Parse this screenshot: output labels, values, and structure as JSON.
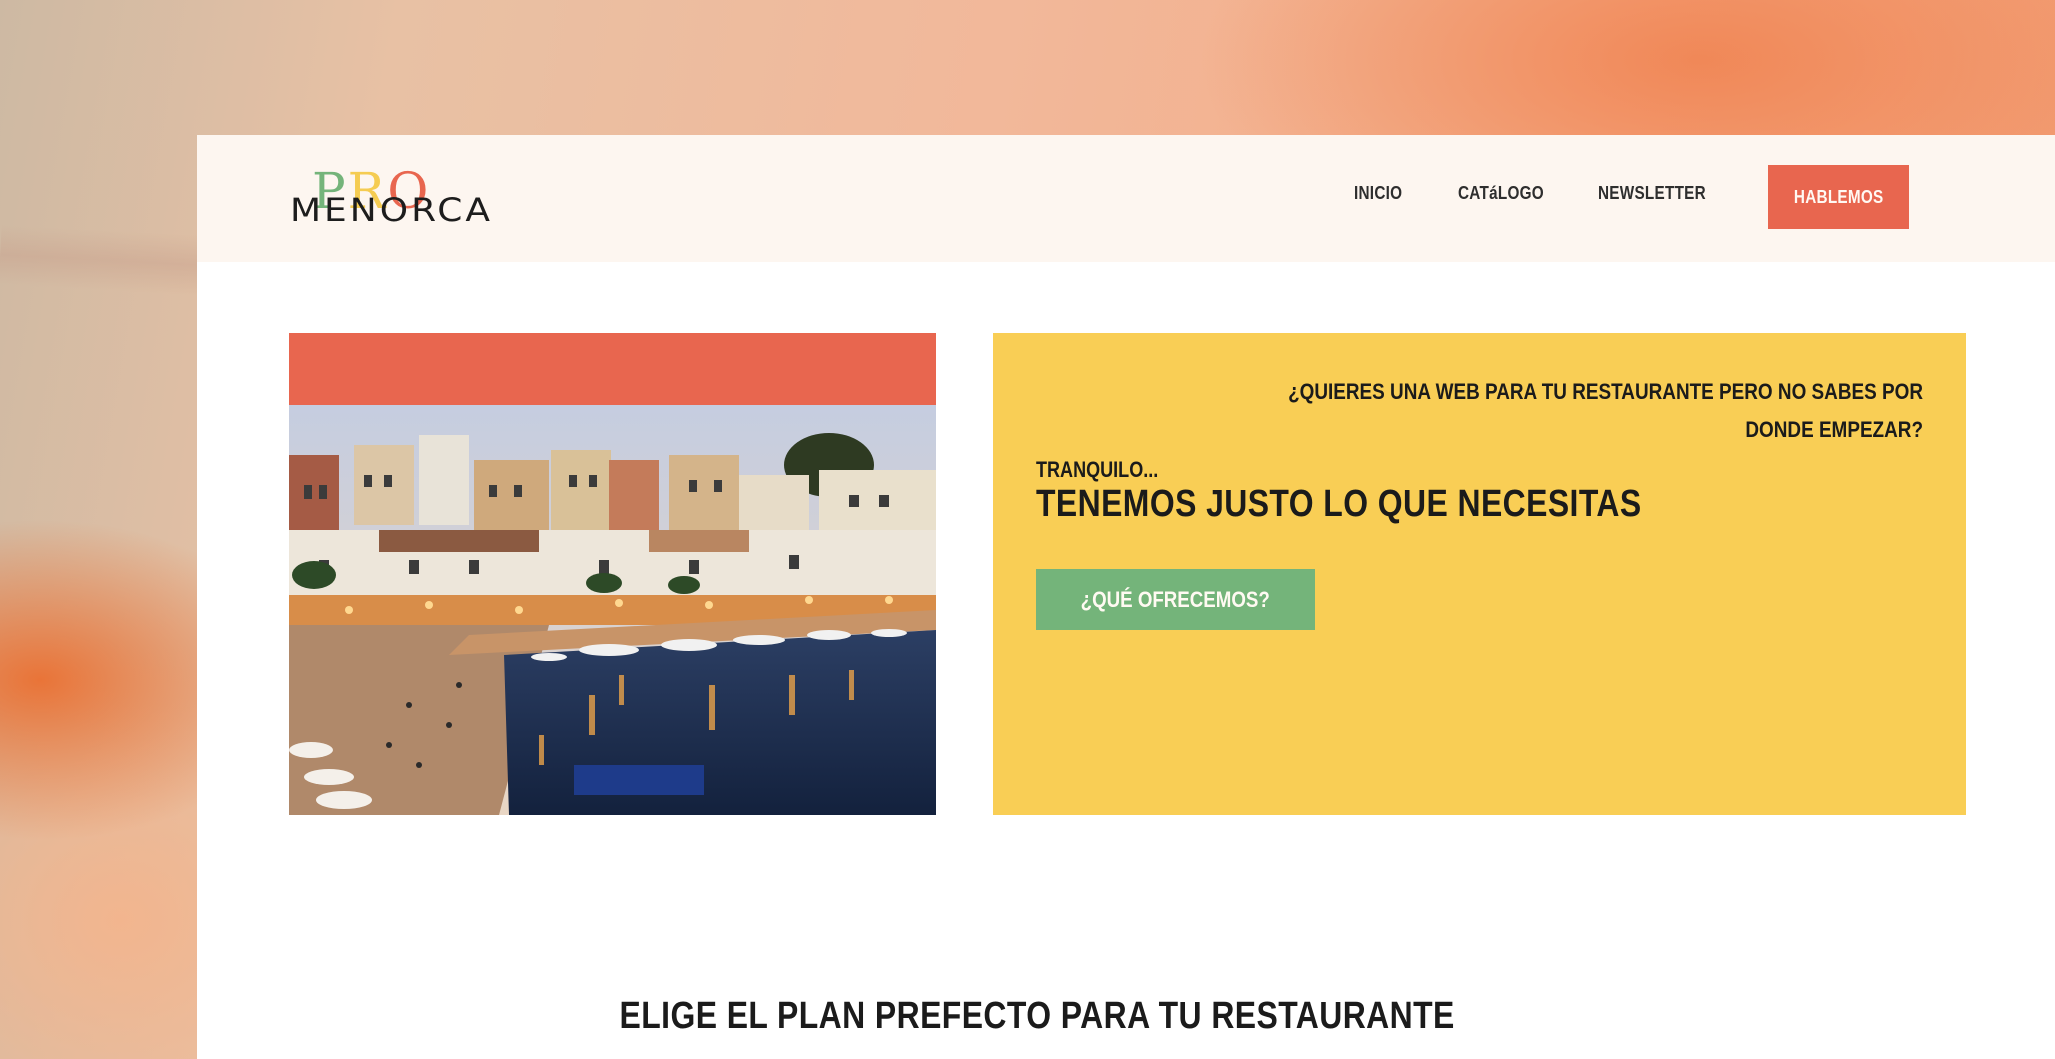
{
  "brand": {
    "logo_top": "PRO",
    "logo_bottom": "MENORCA",
    "colors": {
      "coral": "#e8664f",
      "yellow": "#f9ce55",
      "green": "#74b47a",
      "nav_bg": "#fdf6f0"
    }
  },
  "nav": {
    "links": [
      "INICIO",
      "CATáLOGO",
      "NEWSLETTER"
    ],
    "cta": "HABLEMOS"
  },
  "hero": {
    "photo_description_icon": "harbor-photo",
    "question": "¿QUIERES UNA WEB PARA TU RESTAURANTE PERO NO SABES POR DONDE EMPEZAR?",
    "intro": "TRANQUILO...",
    "headline": "TENEMOS JUSTO LO QUE NECESITAS",
    "button": "¿QUÉ OFRECEMOS?"
  },
  "plans": {
    "title": "ELIGE EL PLAN PREFECTO PARA TU RESTAURANTE"
  }
}
